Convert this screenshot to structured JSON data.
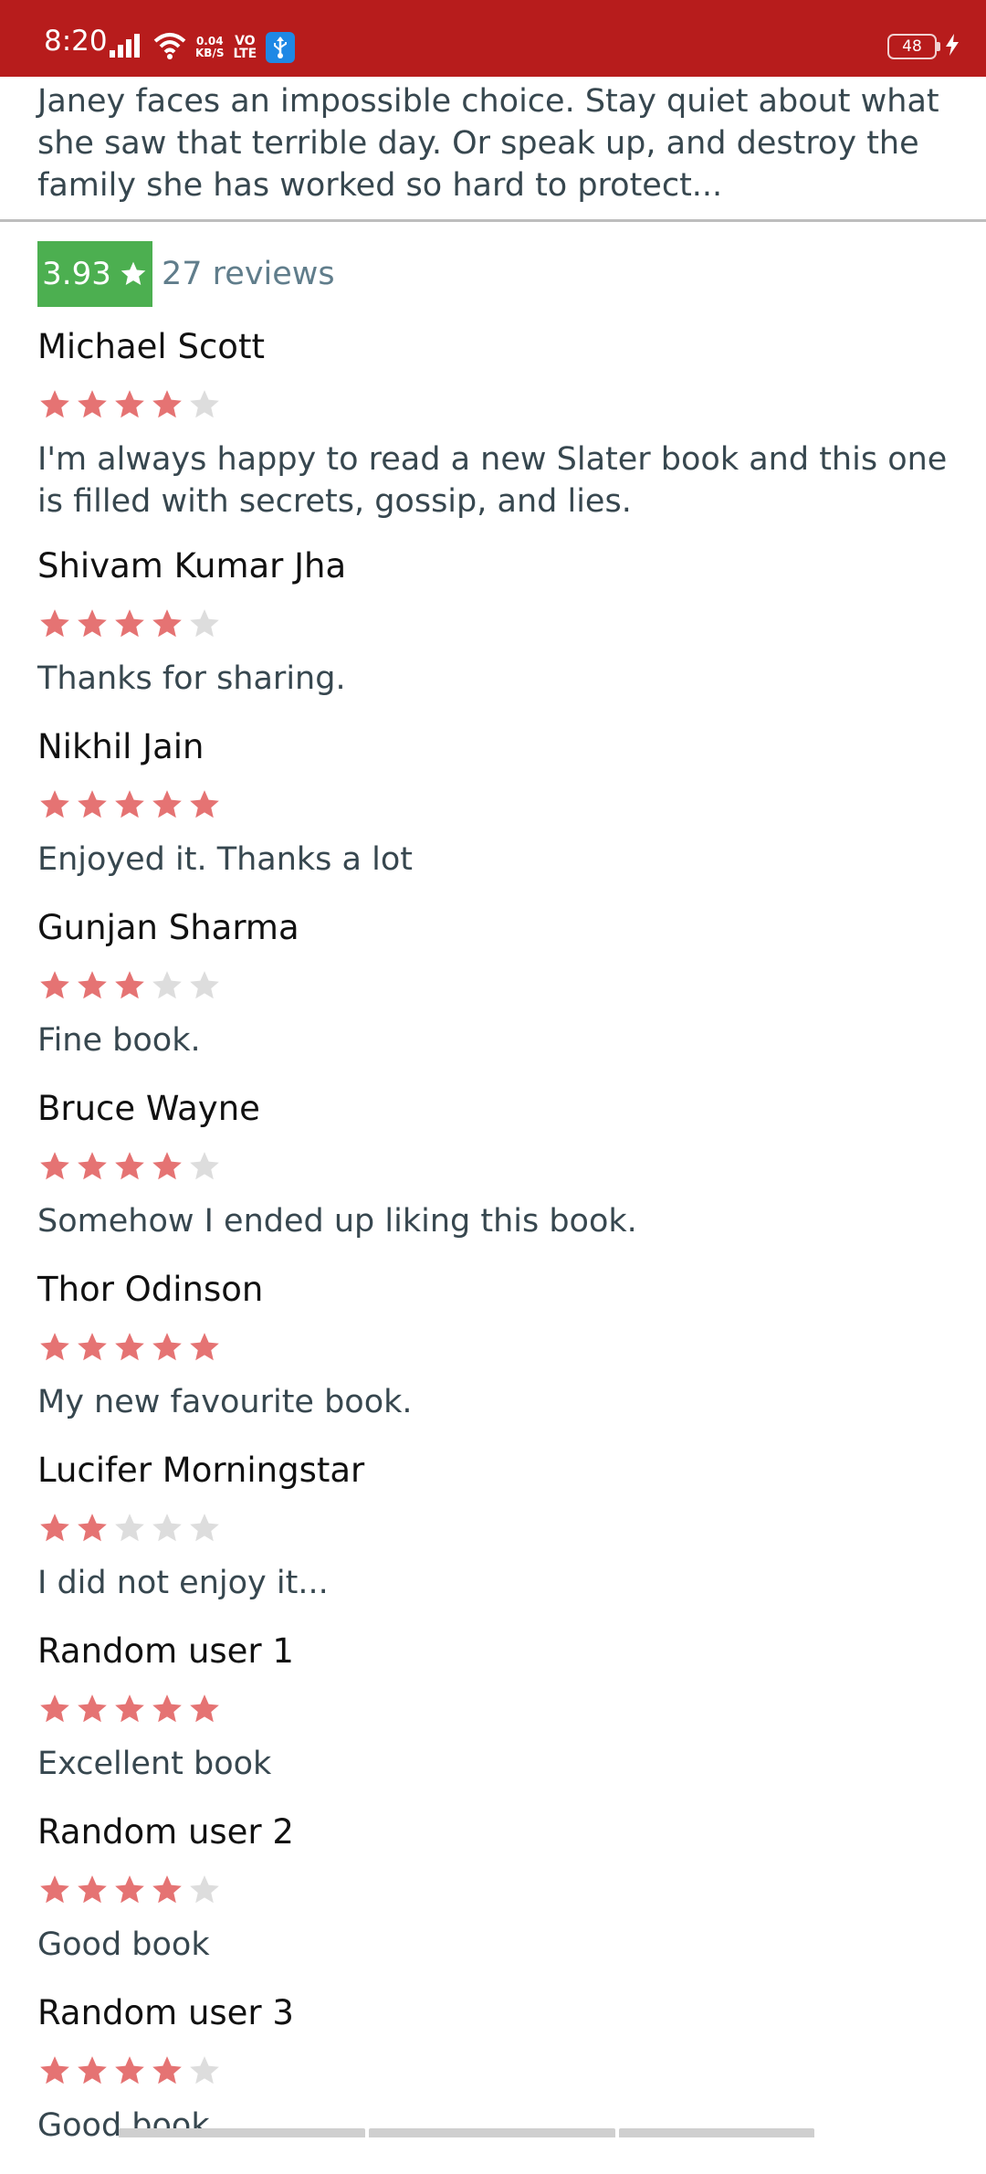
{
  "status_bar": {
    "time": "8:20",
    "net_speed_value": "0.04",
    "net_speed_unit": "KB/S",
    "volte_top": "VO",
    "volte_bottom": "LTE",
    "battery_level": "48",
    "icons": [
      "signal-icon",
      "wifi-icon",
      "usb-icon",
      "battery-icon",
      "charging-icon"
    ]
  },
  "book": {
    "description": "Janey faces an impossible choice. Stay quiet about what she saw that terrible day. Or speak up, and destroy the family she has worked so hard to protect..."
  },
  "rating_summary": {
    "average": "3.93",
    "reviews_label": "27 reviews",
    "badge_color": "#4caf50"
  },
  "colors": {
    "star_filled": "#e57373",
    "star_empty": "#dddddd",
    "status_bar": "#b71c1c"
  },
  "reviews": [
    {
      "name": "Michael Scott",
      "rating": 4,
      "text": "I'm always happy to read a new Slater book and this one is filled with secrets, gossip, and lies."
    },
    {
      "name": "Shivam Kumar Jha",
      "rating": 4,
      "text": "Thanks for sharing."
    },
    {
      "name": "Nikhil Jain",
      "rating": 5,
      "text": "Enjoyed it. Thanks a lot"
    },
    {
      "name": "Gunjan Sharma",
      "rating": 3,
      "text": "Fine book."
    },
    {
      "name": "Bruce Wayne",
      "rating": 4,
      "text": "Somehow I ended up liking this book."
    },
    {
      "name": "Thor Odinson",
      "rating": 5,
      "text": "My new favourite book."
    },
    {
      "name": "Lucifer Morningstar",
      "rating": 2,
      "text": "I did not enjoy it..."
    },
    {
      "name": "Random user 1",
      "rating": 5,
      "text": "Excellent book"
    },
    {
      "name": "Random user 2",
      "rating": 4,
      "text": "Good book"
    },
    {
      "name": "Random user 3",
      "rating": 4,
      "text": "Good book"
    }
  ]
}
